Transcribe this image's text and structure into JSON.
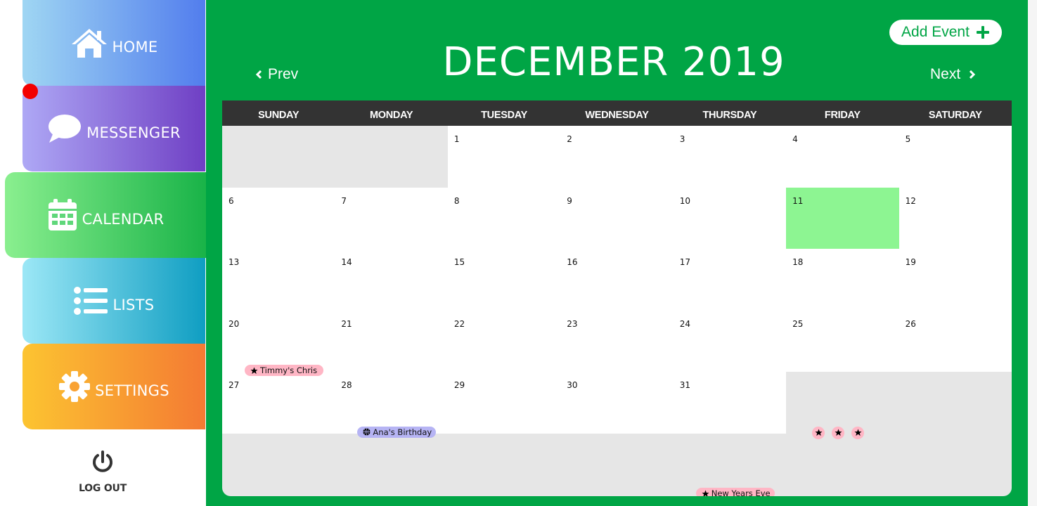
{
  "sidebar": {
    "items": [
      {
        "label": "HOME",
        "icon": "home-icon"
      },
      {
        "label": "MESSENGER",
        "icon": "chat-bubble-icon"
      },
      {
        "label": "CALENDAR",
        "icon": "calendar-icon"
      },
      {
        "label": "LISTS",
        "icon": "list-icon"
      },
      {
        "label": "SETTINGS",
        "icon": "gear-icon"
      }
    ],
    "logout_label": "LOG OUT"
  },
  "header": {
    "title": "DECEMBER 2019",
    "add_event_label": "Add Event",
    "prev_label": "Prev",
    "next_label": "Next"
  },
  "calendar": {
    "weekdays": [
      "SUNDAY",
      "MONDAY",
      "TUESDAY",
      "WEDNESDAY",
      "THURSDAY",
      "FRIDAY",
      "SATURDAY"
    ],
    "days": [
      "1",
      "2",
      "3",
      "4",
      "5",
      "6",
      "7",
      "8",
      "9",
      "10",
      "11",
      "12",
      "13",
      "14",
      "15",
      "16",
      "17",
      "18",
      "19",
      "20",
      "21",
      "22",
      "23",
      "24",
      "25",
      "26",
      "27",
      "28",
      "29",
      "30",
      "31"
    ],
    "today": "11",
    "events": [
      {
        "day": "13",
        "title": "Timmy's Chris",
        "color": "#ffb6c5",
        "icon": "star-icon"
      },
      {
        "day": "21",
        "title": "Ana's Birthday",
        "color": "#b6b4f4",
        "icon": "basketball-icon"
      },
      {
        "day": "31",
        "title": "New Years Eve",
        "color": "#ffb6c5",
        "icon": "star-icon"
      }
    ],
    "dot_events": [
      {
        "day": "25",
        "count": 3,
        "icon": "star-icon"
      }
    ]
  },
  "colors": {
    "main_bg": "#00a545",
    "header_bar": "#333333",
    "today": "#8df592",
    "event_pink": "#ffb6c5",
    "event_purple": "#b6b4f4",
    "notification": "#f30000"
  }
}
